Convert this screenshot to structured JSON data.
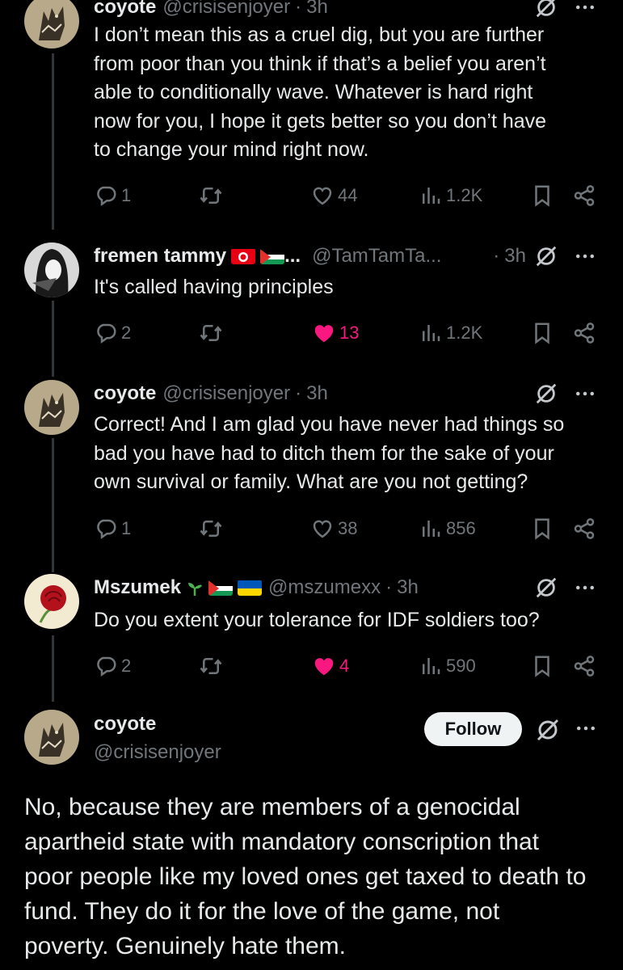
{
  "colors": {
    "background": "#000000",
    "text": "#e7e9ea",
    "muted": "#71767b",
    "like": "#f91880",
    "thread_line": "#333639"
  },
  "replies": [
    {
      "name": "coyote",
      "handle": "@crisisenjoyer",
      "dot": "·",
      "time": "3h",
      "text_lines": [
        "I don’t mean this as a cruel dig, but you are further",
        "from poor than you think if that’s a belief you aren’t",
        "able to conditionally wave. Whatever is hard right",
        "now for you, I hope it gets better so you don’t have",
        "to change your mind right now."
      ],
      "replies": "1",
      "likes": "44",
      "liked": false,
      "views": "1.2K"
    },
    {
      "name": "fremen tammy",
      "name_suffix": "...",
      "handle": "@TamTamTa...",
      "dot": "·",
      "time": "3h",
      "text_lines": [
        "It's called having principles"
      ],
      "replies": "2",
      "likes": "13",
      "liked": true,
      "views": "1.2K"
    },
    {
      "name": "coyote",
      "handle": "@crisisenjoyer",
      "dot": "·",
      "time": "3h",
      "text_lines": [
        "Correct! And I am glad you have never had things so",
        "bad you have had to ditch them for the sake of your",
        "own survival or family. What are you not getting?"
      ],
      "replies": "1",
      "likes": "38",
      "liked": false,
      "views": "856"
    },
    {
      "name": "Mszumek",
      "handle": "@mszumexx",
      "dot": "·",
      "time": "3h",
      "text_lines": [
        "Do you extent your tolerance for IDF soldiers too?"
      ],
      "replies": "2",
      "likes": "4",
      "liked": true,
      "views": "590"
    }
  ],
  "main": {
    "name": "coyote",
    "handle": "@crisisenjoyer",
    "follow_label": "Follow",
    "text_lines": [
      "No, because they are members of a genocidal",
      "apartheid state with mandatory conscription that",
      "poor people like my loved ones get taxed to death to",
      "fund. They do it for the love of the game, not",
      "poverty. Genuinely hate them."
    ]
  },
  "icons": {
    "reply": "reply-icon",
    "retweet": "retweet-icon",
    "like": "heart-icon",
    "views": "views-icon",
    "bookmark": "bookmark-icon",
    "share": "share-icon",
    "grok": "grok-icon",
    "more": "more-icon"
  }
}
